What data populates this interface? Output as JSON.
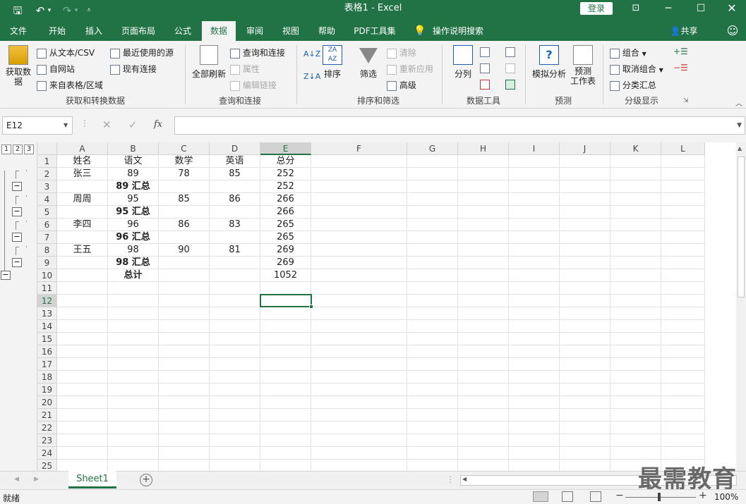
{
  "title": "表格1  -  Excel",
  "login_label": "登录",
  "share_label": "共享",
  "tell_me": "操作说明搜索",
  "tabs": [
    "文件",
    "开始",
    "插入",
    "页面布局",
    "公式",
    "数据",
    "审阅",
    "视图",
    "帮助",
    "PDF工具集"
  ],
  "active_tab": "数据",
  "ribbon": {
    "get_data": "获取数\n据",
    "from_text": "从文本/CSV",
    "from_web": "自网站",
    "from_table": "来自表格/区域",
    "recent_sources": "最近使用的源",
    "existing_conn": "现有连接",
    "group_get": "获取和转换数据",
    "refresh_all": "全部刷新",
    "queries_conn": "查询和连接",
    "properties": "属性",
    "edit_links": "编辑链接",
    "group_queries": "查询和连接",
    "sort": "排序",
    "filter": "筛选",
    "clear": "清除",
    "reapply": "重新应用",
    "advanced": "高级",
    "group_sort": "排序和筛选",
    "text_to_cols": "分列",
    "group_tools": "数据工具",
    "what_if": "模拟分析",
    "forecast_sheet": "预测\n工作表",
    "group_forecast": "预测",
    "group_btn": "组合",
    "ungroup_btn": "取消组合",
    "subtotal_btn": "分类汇总",
    "group_outline": "分级显示"
  },
  "namebox": "E12",
  "formula": "",
  "columns": [
    "A",
    "B",
    "C",
    "D",
    "E",
    "F",
    "G",
    "H",
    "I",
    "J",
    "K",
    "L"
  ],
  "rows": [
    [
      "姓名",
      "语文",
      "数学",
      "英语",
      "总分"
    ],
    [
      "张三",
      "89",
      "78",
      "85",
      "252"
    ],
    [
      "",
      "89 汇总",
      "",
      "",
      "252"
    ],
    [
      "周周",
      "95",
      "85",
      "86",
      "266"
    ],
    [
      "",
      "95 汇总",
      "",
      "",
      "266"
    ],
    [
      "李四",
      "96",
      "86",
      "83",
      "265"
    ],
    [
      "",
      "96 汇总",
      "",
      "",
      "265"
    ],
    [
      "王五",
      "98",
      "90",
      "81",
      "269"
    ],
    [
      "",
      "98 汇总",
      "",
      "",
      "269"
    ],
    [
      "",
      "总计",
      "",
      "",
      "1052"
    ]
  ],
  "row_numbers": [
    "1",
    "2",
    "3",
    "4",
    "5",
    "6",
    "7",
    "8",
    "9",
    "10",
    "11",
    "12",
    "13",
    "14",
    "15",
    "16",
    "17",
    "18",
    "19",
    "20",
    "21",
    "22",
    "23",
    "24",
    "25"
  ],
  "outline_levels": [
    "1",
    "2",
    "3"
  ],
  "sheet_tab": "Sheet1",
  "status_ready": "就绪",
  "zoom": "100%",
  "watermark": "最需教育",
  "colors": {
    "brand": "#217346",
    "selection": "#217346"
  }
}
